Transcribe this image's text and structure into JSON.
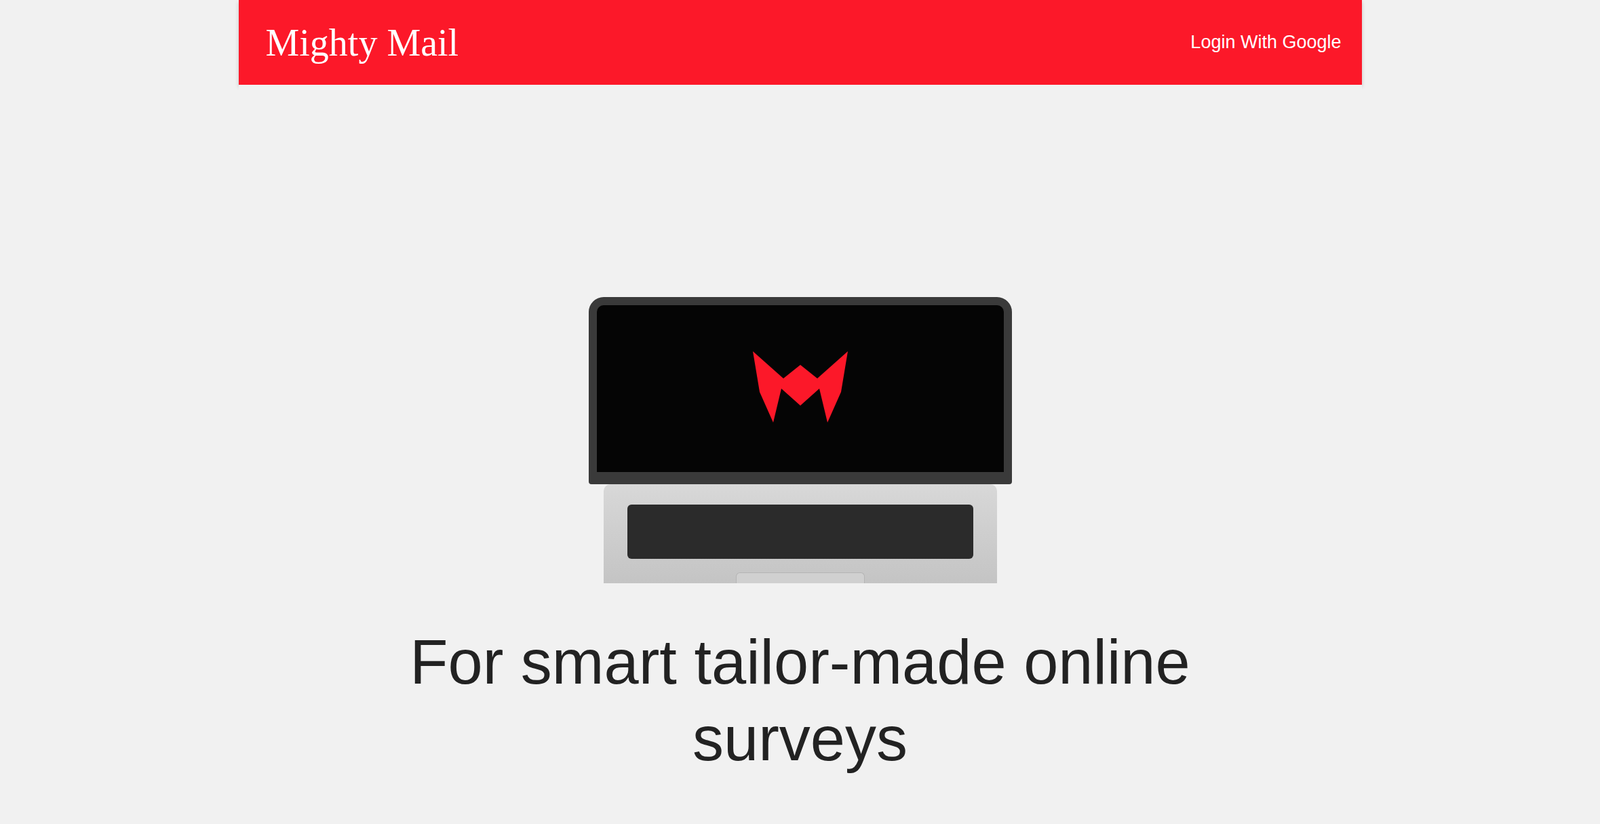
{
  "header": {
    "logo": "Mighty Mail",
    "login": "Login With Google"
  },
  "hero": {
    "headline": "For smart tailor-made online surveys"
  }
}
